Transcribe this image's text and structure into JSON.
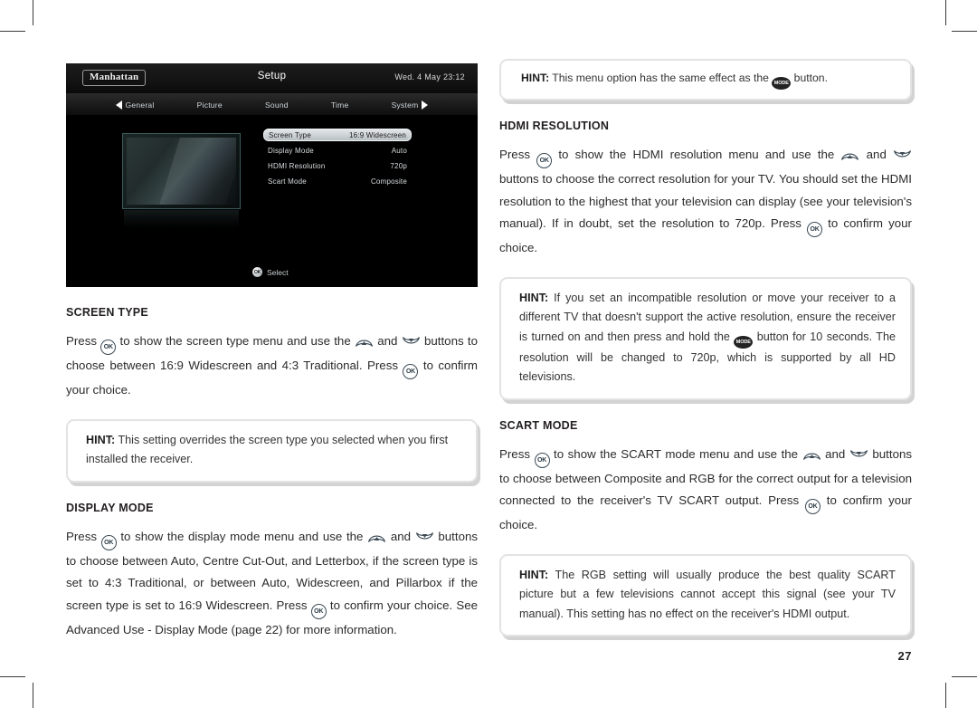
{
  "page": {
    "number": "27"
  },
  "tv_screenshot": {
    "brand_logo": "Manhattan",
    "title": "Setup",
    "datetime": "Wed. 4 May  23:12",
    "nav": {
      "left_arrow": "left-arrow-icon",
      "right_arrow": "right-arrow-icon",
      "tabs": [
        {
          "label": "General"
        },
        {
          "label": "Picture"
        },
        {
          "label": "Sound"
        },
        {
          "label": "Time"
        },
        {
          "label": "System"
        }
      ]
    },
    "menu_rows": [
      {
        "label": "Screen Type",
        "value": "16:9 Widescreen",
        "selected": true
      },
      {
        "label": "Display Mode",
        "value": "Auto",
        "selected": false
      },
      {
        "label": "HDMI Resolution",
        "value": "720p",
        "selected": false
      },
      {
        "label": "Scart Mode",
        "value": "Composite",
        "selected": false
      }
    ],
    "footer": {
      "key": "OK",
      "label": "Select"
    }
  },
  "left_column": {
    "screen_type": {
      "heading": "SCREEN TYPE",
      "para_1": "Press ",
      "para_2": " to show the screen type menu and use the ",
      "para_3": " and ",
      "para_4": " buttons to choose between 16:9 Widescreen and 4:3 Traditional. Press ",
      "para_5": " to confirm your choice."
    },
    "hint_screen_type": {
      "label": "HINT:",
      "text": " This setting overrides the screen type you selected when you first installed the receiver."
    },
    "display_mode": {
      "heading": "DISPLAY MODE",
      "para_1": "Press ",
      "para_2": " to show the display mode menu and use the ",
      "para_3": " and ",
      "para_4": " buttons to choose between Auto, Centre Cut-Out, and Letterbox, if the screen type is set to 4:3 Traditional, or between Auto, Widescreen, and Pillarbox if the screen type is set to 16:9 Widescreen. Press ",
      "para_5": " to confirm your choice. See Advanced Use - Display Mode (page 22) for more information."
    }
  },
  "right_column": {
    "hint_mode_button": {
      "label": "HINT:",
      "text_1": " This menu option has the same effect as the ",
      "text_2": " button."
    },
    "hdmi_resolution": {
      "heading": "HDMI RESOLUTION",
      "para_1": "Press ",
      "para_2": " to show the HDMI resolution menu and use the ",
      "para_3": " and ",
      "para_4": " buttons to choose the correct resolution for your TV. You should set the HDMI resolution to the highest that your television can display (see your television's manual). If in doubt, set the resolution to 720p. Press ",
      "para_5": " to confirm your choice."
    },
    "hint_incompatible": {
      "label": "HINT:",
      "text_1": " If you set an incompatible resolution or move your receiver to a different TV that doesn't support the active resolution, ensure the receiver is turned on and then press and hold the ",
      "text_2": " button for 10 seconds. The resolution will be changed to 720p, which is supported by all HD televisions."
    },
    "scart_mode": {
      "heading": "SCART MODE",
      "para_1": "Press ",
      "para_2": " to show the SCART mode menu and use the ",
      "para_3": " and ",
      "para_4": " buttons to choose between Composite and RGB for the correct output for a television connected to the receiver's TV SCART output. Press ",
      "para_5": " to confirm your choice."
    },
    "hint_rgb": {
      "label": "HINT:",
      "text": " The RGB setting will usually produce the best quality SCART picture but a few televisions cannot accept this signal (see your TV manual). This setting has no effect on the receiver's HDMI output."
    }
  },
  "buttons": {
    "ok": "OK",
    "mode": "MODE"
  }
}
